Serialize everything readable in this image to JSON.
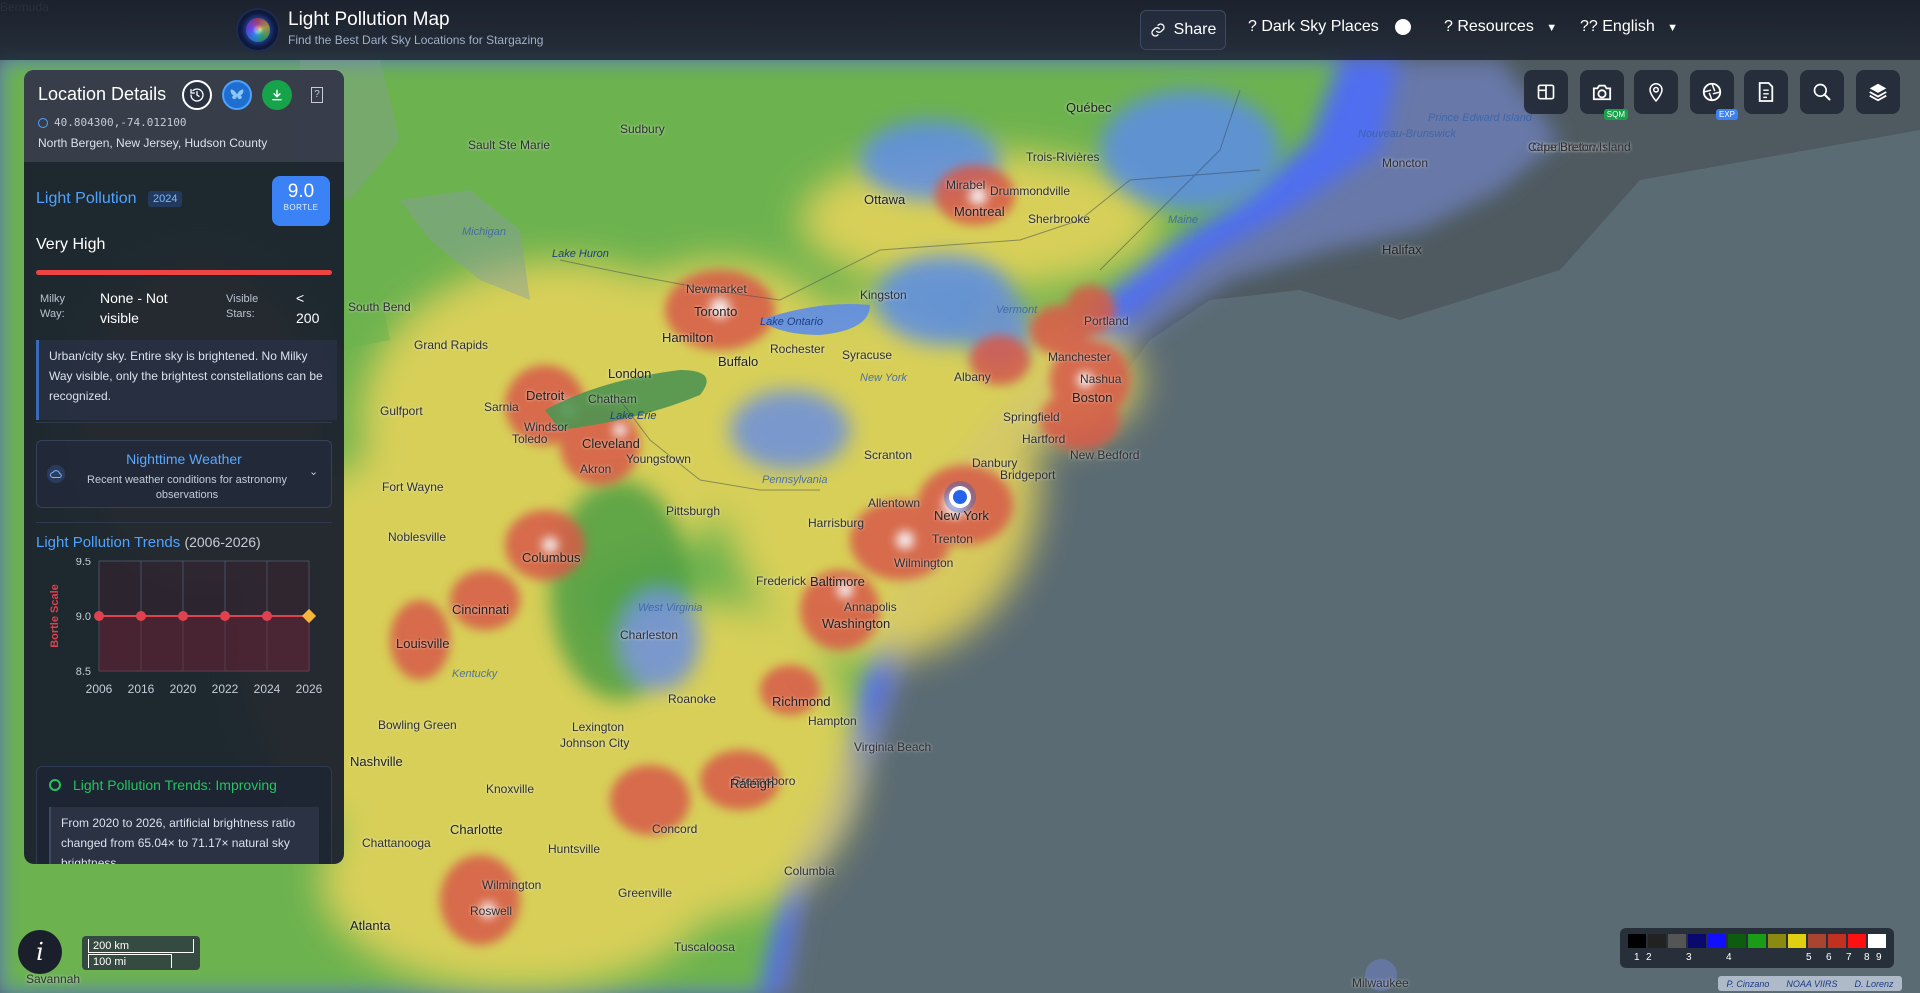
{
  "header": {
    "title": "Light Pollution Map",
    "subtitle": "Find the Best Dark Sky Locations for Stargazing",
    "share_label": "Share",
    "dark_sky_label": "? Dark Sky Places",
    "resources_label": "? Resources",
    "language_label": "?? English"
  },
  "tools": [
    {
      "name": "compare-icon"
    },
    {
      "name": "camera-icon",
      "tag": "SQM",
      "tag_color": "#16a34a"
    },
    {
      "name": "location-pin-icon"
    },
    {
      "name": "aperture-icon",
      "tag": "EXP",
      "tag_color": "#3b82f6"
    },
    {
      "name": "document-icon"
    },
    {
      "name": "search-icon"
    },
    {
      "name": "layers-icon"
    }
  ],
  "panel": {
    "title": "Location Details",
    "coords": "40.804300,-74.012100",
    "place": "North Bergen, New Jersey, Hudson County",
    "lp_label": "Light Pollution",
    "lp_year": "2024",
    "bortle_value": "9.0",
    "bortle_unit": "BORTLE",
    "level": "Very High",
    "level_color": "#ef4444",
    "milky_way_label_1": "Milky",
    "milky_way_label_2": "Way:",
    "milky_way_value_1": "None - Not",
    "milky_way_value_2": "visible",
    "stars_label_1": "Visible",
    "stars_label_2": "Stars:",
    "stars_value_1": "<",
    "stars_value_2": "200",
    "description_1": "Urban/city sky. Entire sky is brightened. No Milky",
    "description_2": "Way visible, only the brightest constellations can be",
    "description_3": "recognized.",
    "weather_title": "Nighttime Weather",
    "weather_desc_1": "Recent weather conditions for astronomy",
    "weather_desc_2": "observations",
    "trends_title": "Light Pollution Trends",
    "trends_range": "(2006-2026)",
    "improve_title": "Light Pollution Trends: Improving",
    "improve_text_1": "From 2020 to 2026, artificial brightness ratio",
    "improve_text_2": "changed from 65.04× to 71.17× natural sky",
    "improve_text_3": "brightness."
  },
  "chart_data": {
    "type": "line",
    "x": [
      "2006",
      "2016",
      "2020",
      "2022",
      "2024",
      "2026"
    ],
    "values": [
      9.0,
      9.0,
      9.0,
      9.0,
      9.0,
      9.0
    ],
    "ylabel": "Bortle Scale",
    "ylim": [
      8.5,
      9.5
    ],
    "yticks": [
      "9.5",
      "9.0",
      "8.5"
    ],
    "line_color": "#e0414f",
    "last_point_color": "#f6b63a"
  },
  "map": {
    "labels": [
      {
        "t": "Québec",
        "cls": "city"
      },
      {
        "t": "Sudbury"
      },
      {
        "t": "Sault Ste Marie"
      },
      {
        "t": "Trois-Rivières"
      },
      {
        "t": "Ottawa",
        "cls": "city"
      },
      {
        "t": "Montreal",
        "cls": "city"
      },
      {
        "t": "Sherbrooke"
      },
      {
        "t": "Drummondville"
      },
      {
        "t": "Mirabel"
      },
      {
        "t": "Prince Edward Island",
        "cls": "region"
      },
      {
        "t": "Charlottetown"
      },
      {
        "t": "Moncton"
      },
      {
        "t": "Cape Breton Island"
      },
      {
        "t": "Halifax",
        "cls": "city"
      },
      {
        "t": "Nouveau-Brunswick",
        "cls": "region"
      },
      {
        "t": "Maine",
        "cls": "region"
      },
      {
        "t": "Lake Huron",
        "cls": "water"
      },
      {
        "t": "Michigan",
        "cls": "region"
      },
      {
        "t": "Newmarket"
      },
      {
        "t": "Toronto",
        "cls": "city"
      },
      {
        "t": "Kingston"
      },
      {
        "t": "Lake Ontario",
        "cls": "water"
      },
      {
        "t": "Hamilton",
        "cls": "city"
      },
      {
        "t": "Buffalo",
        "cls": "city"
      },
      {
        "t": "Rochester"
      },
      {
        "t": "Syracuse"
      },
      {
        "t": "Albany"
      },
      {
        "t": "Vermont",
        "cls": "region"
      },
      {
        "t": "Portland"
      },
      {
        "t": "Manchester"
      },
      {
        "t": "Nashua"
      },
      {
        "t": "Boston",
        "cls": "city"
      },
      {
        "t": "London",
        "cls": "city"
      },
      {
        "t": "Detroit",
        "cls": "city"
      },
      {
        "t": "Chatham"
      },
      {
        "t": "Lake Erie",
        "cls": "water"
      },
      {
        "t": "Grand Rapids"
      },
      {
        "t": "Sarnia"
      },
      {
        "t": "Windsor"
      },
      {
        "t": "Toledo"
      },
      {
        "t": "New York",
        "cls": "region"
      },
      {
        "t": "Springfield"
      },
      {
        "t": "Hartford"
      },
      {
        "t": "New Bedford"
      },
      {
        "t": "Danbury"
      },
      {
        "t": "Bridgeport"
      },
      {
        "t": "Scranton"
      },
      {
        "t": "Cleveland",
        "cls": "city"
      },
      {
        "t": "Akron"
      },
      {
        "t": "Youngstown"
      },
      {
        "t": "Pennsylvania",
        "cls": "region"
      },
      {
        "t": "New York",
        "cls": "city"
      },
      {
        "t": "Allentown"
      },
      {
        "t": "Harrisburg"
      },
      {
        "t": "Pittsburgh"
      },
      {
        "t": "Trenton"
      },
      {
        "t": "Wilmington"
      },
      {
        "t": "Columbus",
        "cls": "city"
      },
      {
        "t": "Fort Wayne"
      },
      {
        "t": "Noblesville"
      },
      {
        "t": "Frederick"
      },
      {
        "t": "Baltimore",
        "cls": "city"
      },
      {
        "t": "Annapolis"
      },
      {
        "t": "Washington",
        "cls": "city"
      },
      {
        "t": "Cincinnati",
        "cls": "city"
      },
      {
        "t": "West Virginia",
        "cls": "region"
      },
      {
        "t": "Charleston"
      },
      {
        "t": "Louisville",
        "cls": "city"
      },
      {
        "t": "Kentucky",
        "cls": "region"
      },
      {
        "t": "Roanoke"
      },
      {
        "t": "Richmond",
        "cls": "city"
      },
      {
        "t": "Lexington"
      },
      {
        "t": "Hampton"
      },
      {
        "t": "Virginia Beach"
      },
      {
        "t": "Johnson City"
      },
      {
        "t": "Bowling Green"
      },
      {
        "t": "Nashville",
        "cls": "city"
      },
      {
        "t": "Knoxville"
      },
      {
        "t": "Greensboro"
      },
      {
        "t": "Raleigh",
        "cls": "city"
      },
      {
        "t": "Concord"
      },
      {
        "t": "Charlotte",
        "cls": "city"
      },
      {
        "t": "Chattanooga"
      },
      {
        "t": "Huntsville"
      },
      {
        "t": "Greenville"
      },
      {
        "t": "Columbia"
      },
      {
        "t": "Wilmington"
      },
      {
        "t": "Roswell"
      },
      {
        "t": "Atlanta",
        "cls": "city"
      },
      {
        "t": "Tuscaloosa"
      },
      {
        "t": "Savannah"
      },
      {
        "t": "Gulfport"
      },
      {
        "t": "South Bend"
      },
      {
        "t": "Milwaukee"
      },
      {
        "t": "Bermuda",
        "cls": "white"
      }
    ]
  },
  "scale": {
    "km": "200 km",
    "mi": "100 mi"
  },
  "legend": {
    "colors": [
      "#000000",
      "#222222",
      "#555555",
      "#0a0a6e",
      "#1010ff",
      "#0e5c10",
      "#1a9c18",
      "#8a8a10",
      "#e0d010",
      "#a84430",
      "#c23020",
      "#ff1010",
      "#ffffff"
    ],
    "nums": [
      "1",
      "2",
      "3",
      "4",
      "5",
      "6",
      "7",
      "8",
      "9"
    ]
  },
  "attribution": [
    "P. Cinzano",
    "NOAA VIIRS",
    "D. Lorenz"
  ],
  "info_label": "i"
}
